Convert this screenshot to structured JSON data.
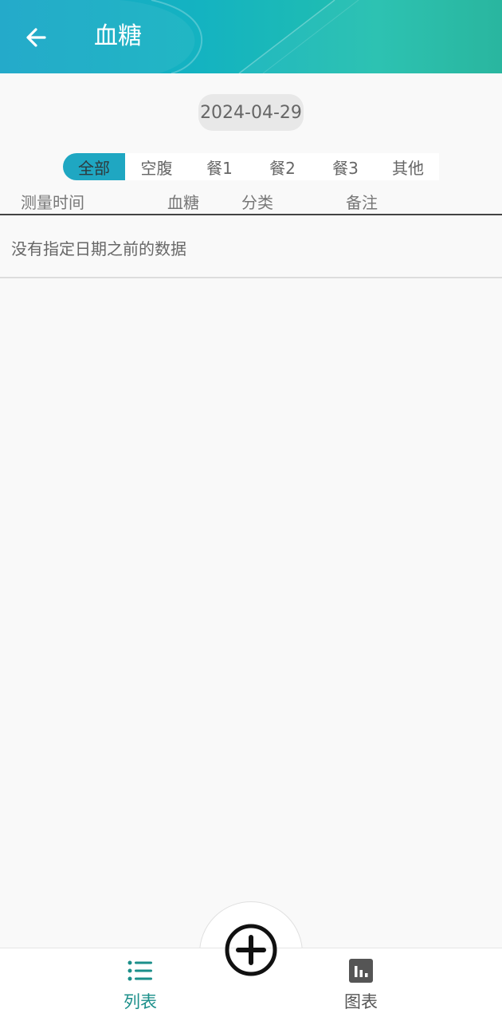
{
  "header": {
    "title": "血糖",
    "back_icon": "arrow-left-icon"
  },
  "date_picker": {
    "value": "2024-04-29"
  },
  "category_tabs": {
    "items": [
      {
        "label": "全部",
        "active": true
      },
      {
        "label": "空腹",
        "active": false
      },
      {
        "label": "餐1",
        "active": false
      },
      {
        "label": "餐2",
        "active": false
      },
      {
        "label": "餐3",
        "active": false
      },
      {
        "label": "其他",
        "active": false
      }
    ]
  },
  "table": {
    "columns": [
      "测量时间",
      "血糖",
      "分类",
      "备注"
    ],
    "empty_message": "没有指定日期之前的数据"
  },
  "bottom_nav": {
    "items": [
      {
        "label": "列表",
        "icon": "list-icon",
        "active": true
      },
      {
        "label": "图表",
        "icon": "bar-chart-icon",
        "active": false
      }
    ],
    "fab_icon": "add-circle-icon"
  },
  "colors": {
    "accent": "#1fa7c2",
    "active_nav": "#1b8f8a",
    "inactive_nav": "#555555"
  }
}
